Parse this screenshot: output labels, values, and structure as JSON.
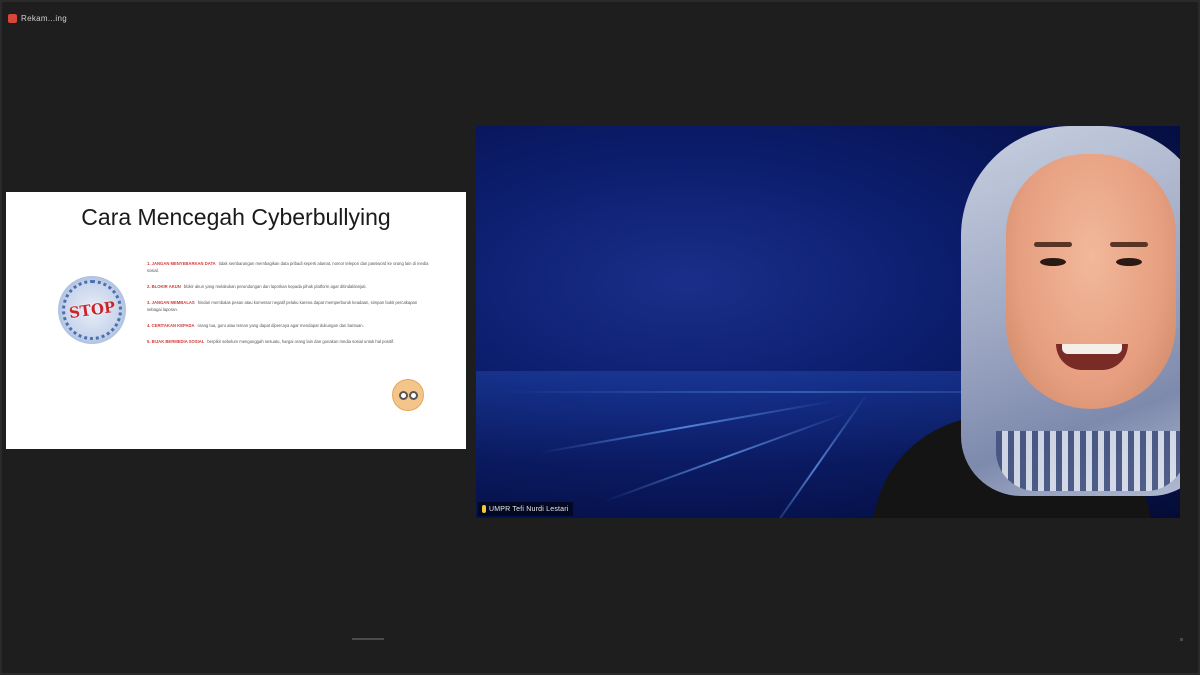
{
  "window": {
    "recording_label": "Rekam...ing"
  },
  "slide": {
    "title": "Cara Mencegah Cyberbullying",
    "badge_text": "STOP",
    "tips": [
      {
        "lead": "1. JANGAN MENYEBARKAN DATA",
        "text": "tidak sembarangan membagikan data pribadi seperti alamat, nomor telepon dan password ke orang lain di media sosial."
      },
      {
        "lead": "2. BLOKIR AKUN",
        "text": "blokir akun yang melakukan perundungan dan laporkan kepada pihak platform agar ditindaklanjuti."
      },
      {
        "lead": "3. JANGAN MEMBALAS",
        "text": "hindari membalas pesan atau komentar negatif pelaku karena dapat memperburuk keadaan, simpan bukti percakapan sebagai laporan."
      },
      {
        "lead": "4. CERITAKAN KEPADA",
        "text": "orang tua, guru atau teman yang dapat dipercaya agar mendapat dukungan dan bantuan."
      },
      {
        "lead": "5. BIJAK BERMEDIA SOSIAL",
        "text": "berpikir sebelum mengunggah sesuatu, hargai orang lain dan gunakan media sosial untuk hal positif."
      }
    ]
  },
  "video": {
    "participant_name": "UMPR Tefi Nurdi Lestari"
  },
  "colors": {
    "accent_red": "#d23b3b",
    "video_bg": "#0b1c6b",
    "window_bg": "#1e1e1e"
  }
}
